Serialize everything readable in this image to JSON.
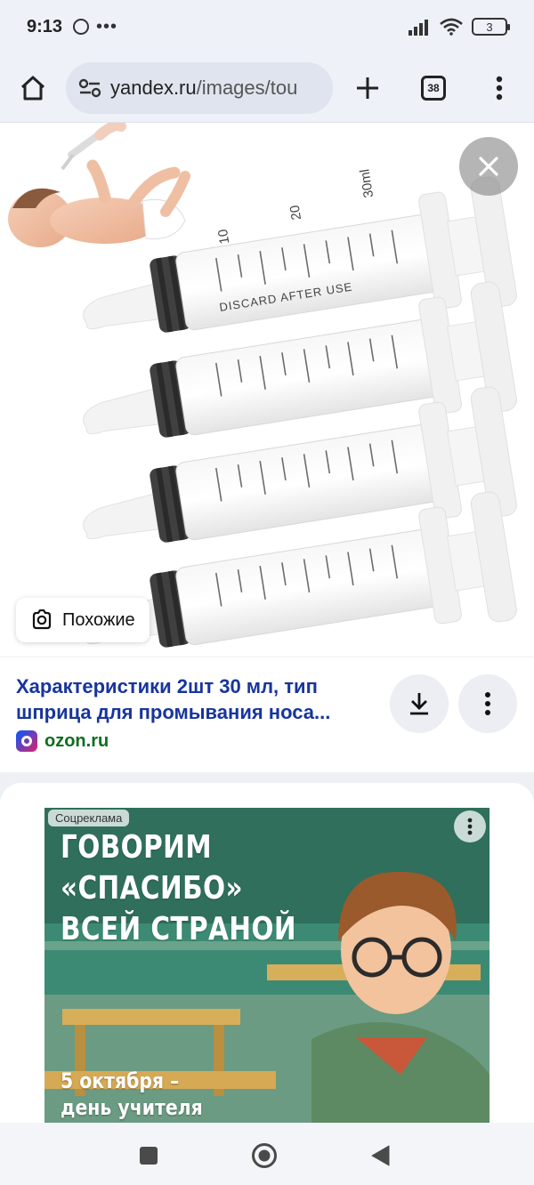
{
  "status_bar": {
    "time": "9:13",
    "battery": "3"
  },
  "browser": {
    "url_host": "yandex.ru",
    "url_path": "/images/tou",
    "tabs_count": "38"
  },
  "viewer": {
    "similar_label": "Похожие",
    "syringe_markings": {
      "mark_10": "10",
      "mark_20": "20",
      "mark_30": "30ml",
      "discard_text": "DISCARD AFTER USE"
    }
  },
  "result": {
    "title": "Характеристики 2шт 30 мл, тип шприца для промывания носа...",
    "source_domain": "ozon.ru"
  },
  "ad": {
    "badge": "Соцреклама",
    "headline_line1": "ГОВОРИМ «СПАСИБО»",
    "headline_line2": "ВСЕЙ СТРАНОЙ",
    "date_line1": "5 октября –",
    "date_line2": "день учителя"
  },
  "colors": {
    "title_link": "#17359c",
    "source_green": "#0f6e1e",
    "chrome_bg": "#eef1f8"
  },
  "icons": {
    "home": "home-icon",
    "site_settings": "tune-icon",
    "new_tab": "plus-icon",
    "menu": "kebab-menu-icon",
    "close": "close-icon",
    "similar": "lens-search-icon",
    "download": "download-icon",
    "nav_recents": "square-icon",
    "nav_home": "circle-icon",
    "nav_back": "triangle-back-icon"
  }
}
